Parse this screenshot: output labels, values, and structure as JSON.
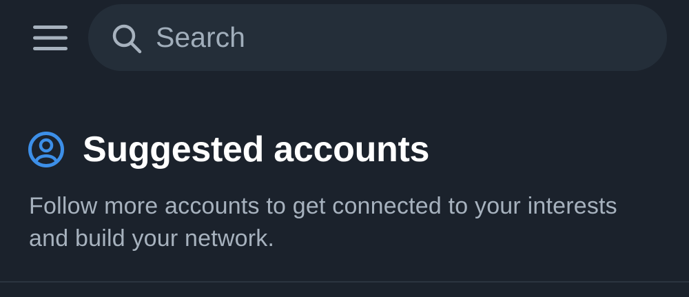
{
  "header": {
    "menu_icon": "hamburger-menu-icon",
    "search": {
      "icon": "search-icon",
      "placeholder": "Search",
      "value": ""
    }
  },
  "suggested": {
    "icon": "account-circle-icon",
    "title": "Suggested accounts",
    "description": "Follow more accounts to get connected to your interests and build your network."
  },
  "colors": {
    "background": "#1b222c",
    "search_background": "#242e39",
    "accent": "#3d8fe8",
    "title": "#ffffff",
    "muted_text": "#a7b2be"
  }
}
